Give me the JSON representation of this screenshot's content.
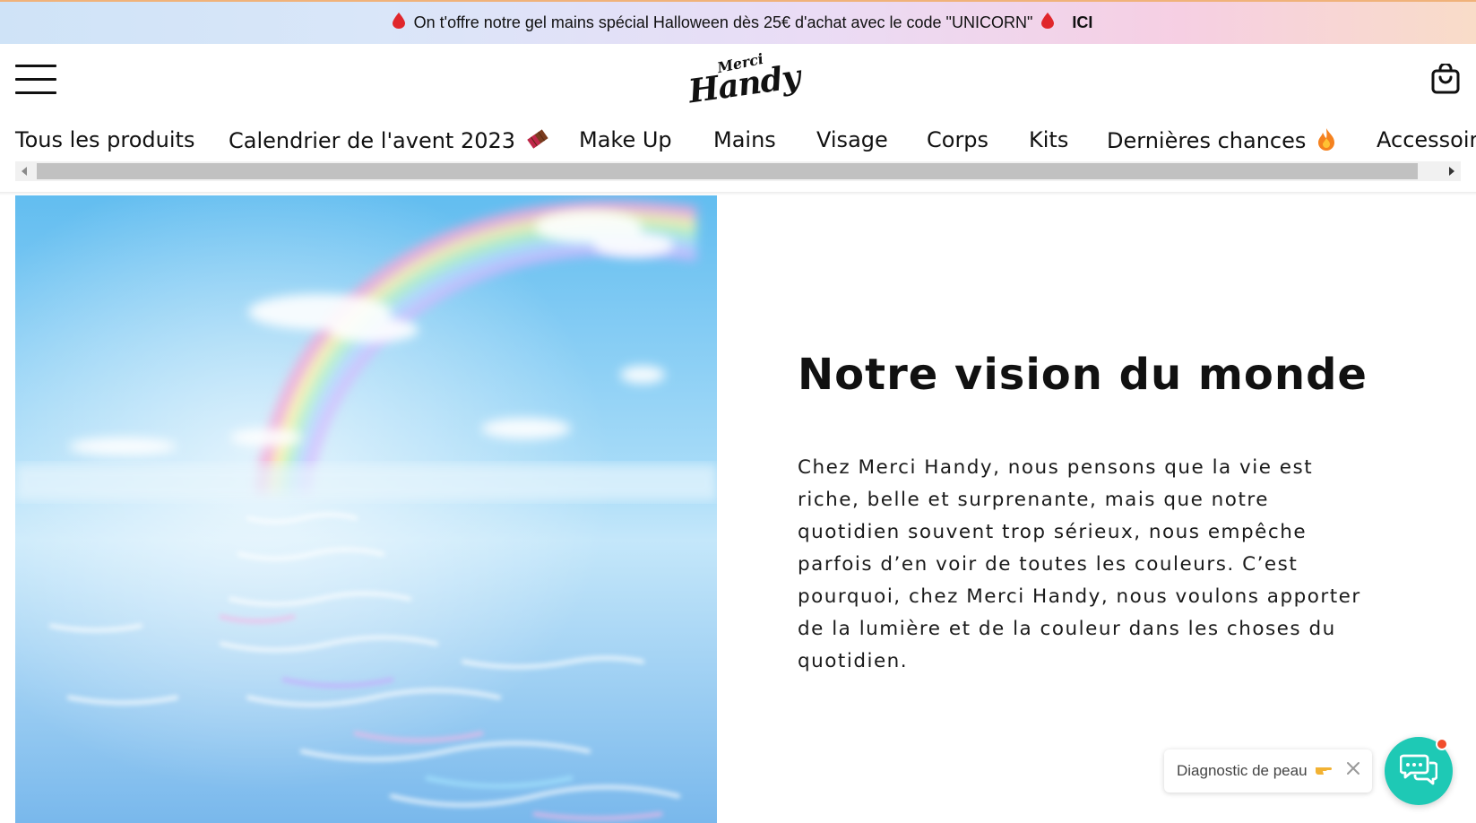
{
  "promo": {
    "text": "On t'offre notre gel mains spécial Halloween dès 25€ d'achat avec le code \"UNICORN\"",
    "cta": "ICI",
    "drop_icon": "blood-drop-icon",
    "drop_color": "#e0262b"
  },
  "header": {
    "logo_small": "Merci",
    "logo_big": "Handy",
    "menu_icon": "hamburger-menu-icon",
    "cart_icon": "shopping-bag-icon"
  },
  "nav": {
    "items": [
      {
        "label": "Tous les produits",
        "emoji": ""
      },
      {
        "label": "Calendrier de l'avent 2023",
        "emoji": "chocolate-icon"
      },
      {
        "label": "Make Up",
        "emoji": ""
      },
      {
        "label": "Mains",
        "emoji": ""
      },
      {
        "label": "Visage",
        "emoji": ""
      },
      {
        "label": "Corps",
        "emoji": ""
      },
      {
        "label": "Kits",
        "emoji": ""
      },
      {
        "label": "Dernières chances",
        "emoji": "fire-icon"
      },
      {
        "label": "Accessoires",
        "emoji": ""
      }
    ]
  },
  "vision": {
    "title": "Notre vision du monde",
    "lines": [
      "Chez Merci Handy, nous pensons que la vie est",
      "riche, belle et surprenante, mais que notre",
      "quotidien souvent trop sérieux, nous empêche",
      "parfois d’en voir de toutes les couleurs. C’est",
      "pourquoi, chez Merci Handy, nous voulons apporter",
      "de la lumière et de la couleur dans les choses du",
      "quotidien."
    ]
  },
  "chat": {
    "diagnostic_label": "Diagnostic de peau",
    "accent": "#1ec9b5",
    "badge_color": "#f14d2b"
  }
}
